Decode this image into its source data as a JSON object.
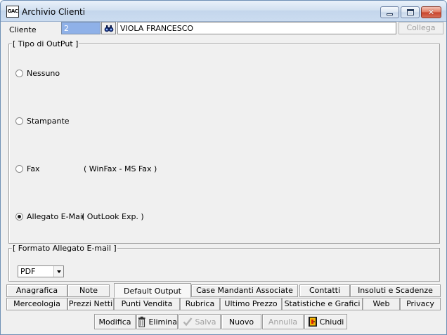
{
  "window": {
    "app_icon_text": "GAC",
    "title": "Archivio Clienti"
  },
  "client": {
    "label": "Cliente",
    "code": "2",
    "name": "VIOLA FRANCESCO",
    "collega_label": "Collega"
  },
  "output_group": {
    "legend": "[ Tipo di OutPut ]",
    "options": [
      {
        "label": "Nessuno",
        "checked": false,
        "note": ""
      },
      {
        "label": "Stampante",
        "checked": false,
        "note": ""
      },
      {
        "label": "Fax",
        "checked": false,
        "note": "( WinFax - MS Fax )"
      },
      {
        "label": "Allegato E-Mail",
        "checked": true,
        "note": "( OutLook Exp. )"
      }
    ]
  },
  "format_group": {
    "legend": "[ Formato Allegato E-mail ]",
    "selected": "PDF"
  },
  "tabs_row1": [
    "Anagrafica",
    "Note",
    "Default Output",
    "Case Mandanti Associate",
    "Contatti",
    "Insoluti e Scadenze"
  ],
  "tabs_row2": [
    "Merceologia",
    "Prezzi Netti",
    "Punti Vendita",
    "Rubrica",
    "Ultimo Prezzo",
    "Statistiche e Grafici",
    "Web",
    "Privacy"
  ],
  "active_tab": "Default Output",
  "toolbar": {
    "modifica": "Modifica",
    "elimina": "Elimina",
    "salva": "Salva",
    "nuovo": "Nuovo",
    "annulla": "Annulla",
    "chiudi": "Chiudi"
  }
}
